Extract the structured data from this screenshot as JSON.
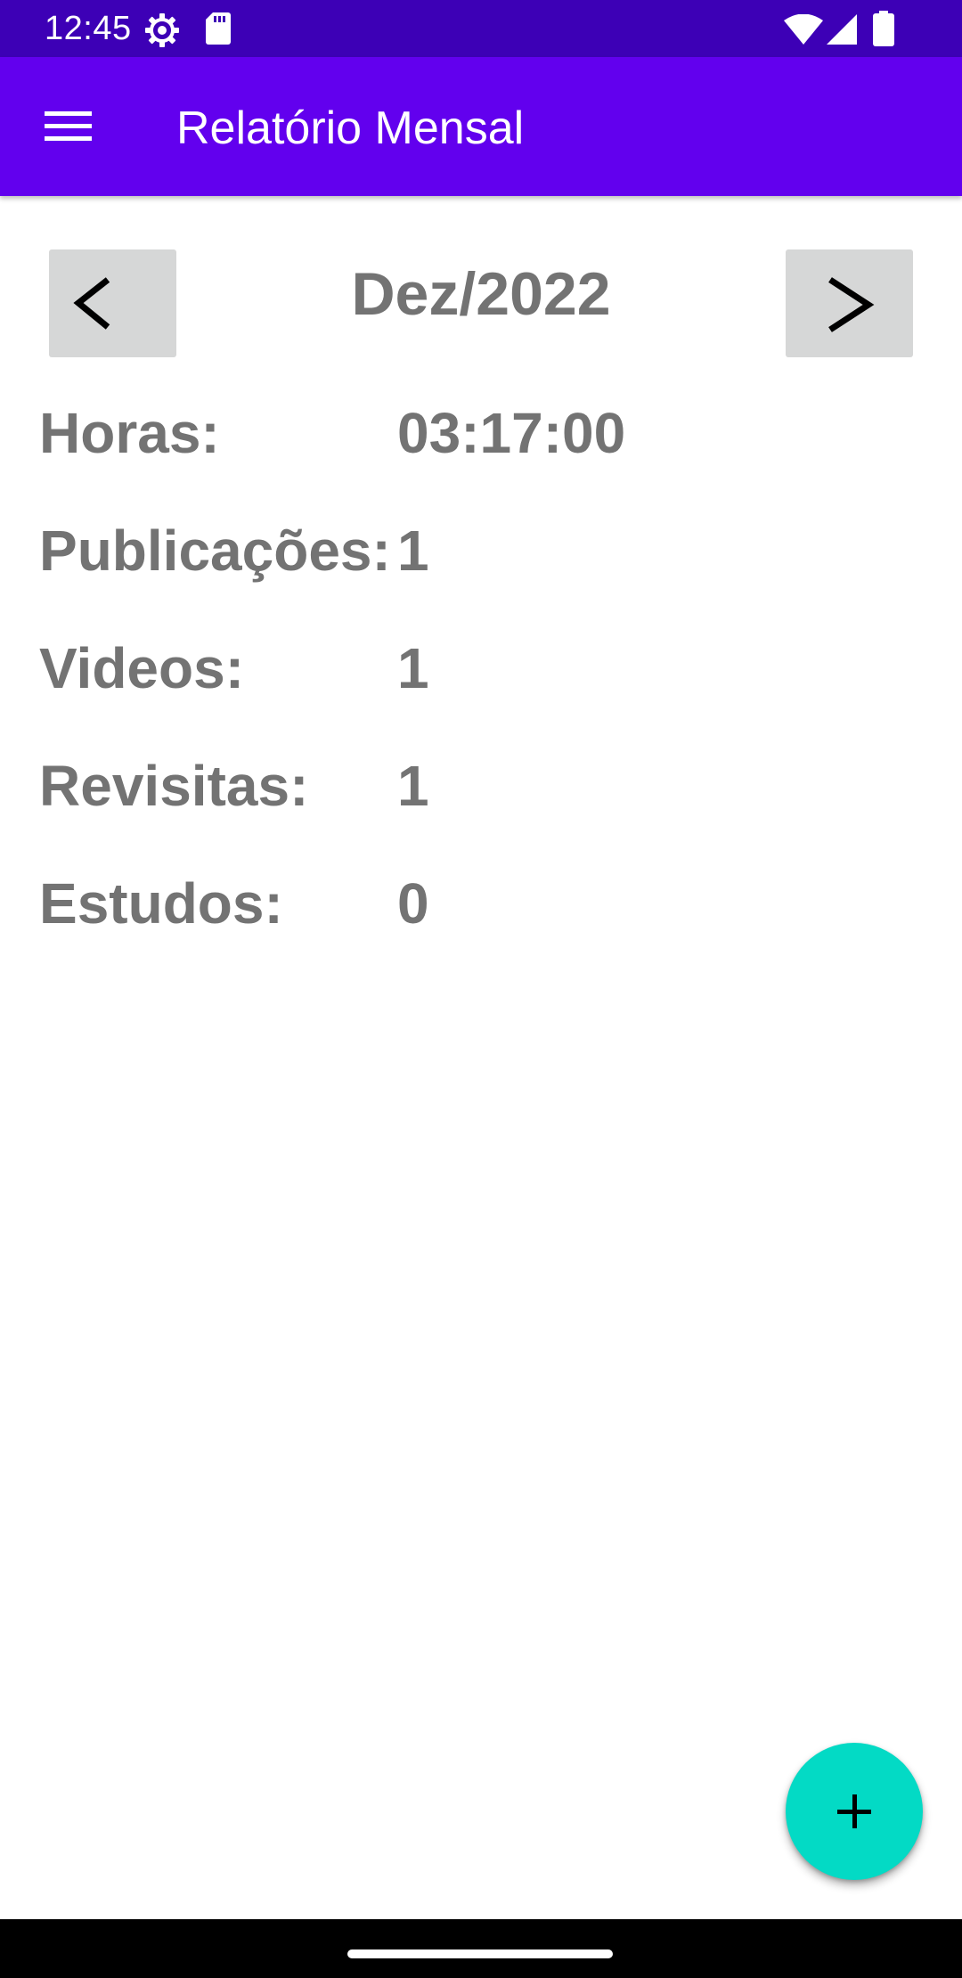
{
  "status_bar": {
    "time": "12:45",
    "icons": [
      "settings-icon",
      "sd-card-icon",
      "wifi-icon",
      "signal-icon",
      "battery-icon"
    ]
  },
  "app_bar": {
    "title": "Relatório Mensal",
    "menu_icon": "menu-icon"
  },
  "month_nav": {
    "label": "Dez/2022",
    "prev_icon": "chevron-left-icon",
    "next_icon": "chevron-right-icon"
  },
  "report": {
    "rows": [
      {
        "label": "Horas:",
        "value": "03:17:00"
      },
      {
        "label": "Publicações:",
        "value": "1"
      },
      {
        "label": "Videos:",
        "value": "1"
      },
      {
        "label": "Revisitas:",
        "value": "1"
      },
      {
        "label": "Estudos:",
        "value": "0"
      }
    ]
  },
  "fab": {
    "icon": "plus-icon"
  },
  "colors": {
    "status_bar": "#3d00b6",
    "app_bar": "#6200ee",
    "fab": "#03dac5",
    "nav_button": "#d6d7d7",
    "text_gray": "#737373"
  }
}
